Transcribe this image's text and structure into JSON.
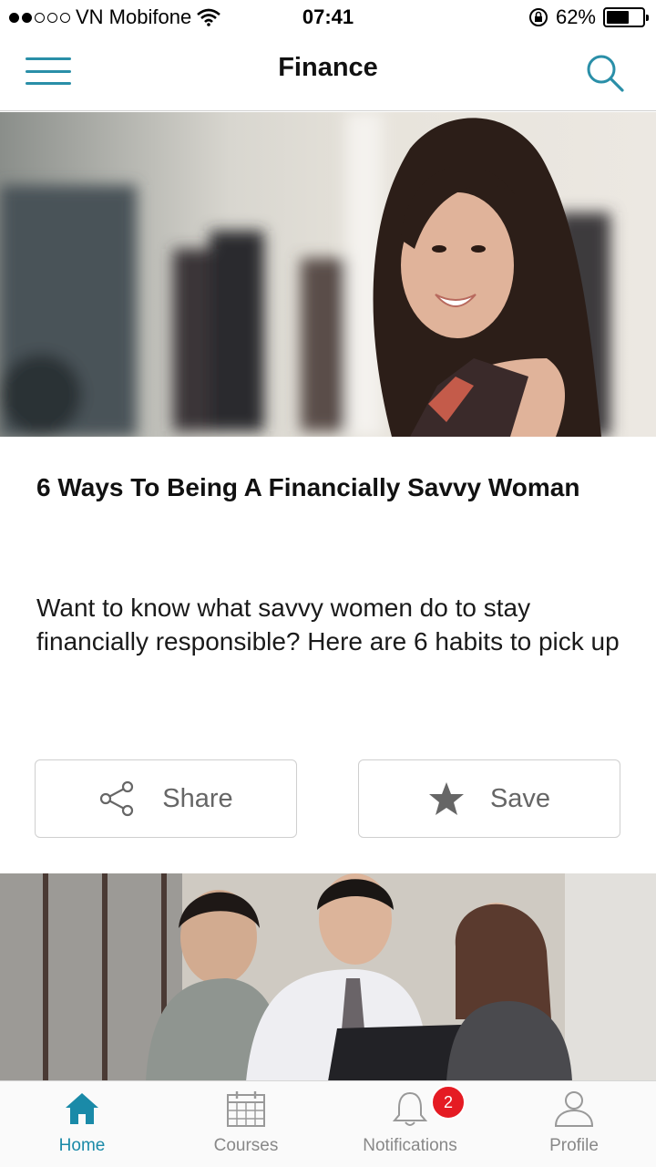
{
  "status_bar": {
    "carrier": "VN Mobifone",
    "time": "07:41",
    "battery_percent": "62%",
    "battery_level": 0.62,
    "signal_filled": 2,
    "signal_total": 5
  },
  "nav": {
    "title": "Finance",
    "accent_color": "#2a8fa8"
  },
  "article": {
    "title": "6 Ways To Being A Financially Savvy Woman",
    "description": "Want to know what savvy women do to stay financially responsible? Here are 6 habits to pick up",
    "share_label": "Share",
    "save_label": "Save"
  },
  "tabs": [
    {
      "label": "Home",
      "icon": "home-icon",
      "active": true
    },
    {
      "label": "Courses",
      "icon": "calendar-icon",
      "active": false
    },
    {
      "label": "Notifications",
      "icon": "bell-icon",
      "active": false,
      "badge": "2"
    },
    {
      "label": "Profile",
      "icon": "person-icon",
      "active": false
    }
  ],
  "colors": {
    "accent": "#1a8aa8",
    "badge": "#e51b23",
    "inactive_icon": "#999999"
  }
}
